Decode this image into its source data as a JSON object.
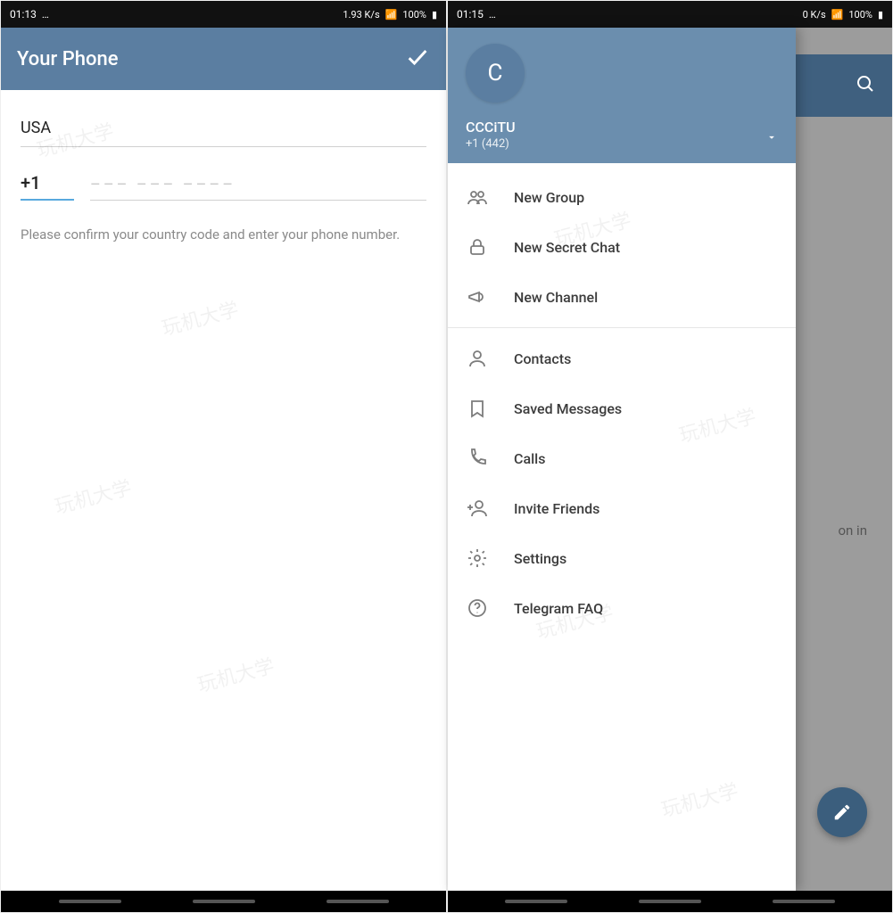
{
  "left": {
    "status": {
      "time": "01:13",
      "net_speed": "1.93 K/s",
      "battery": "100%"
    },
    "appbar": {
      "title": "Your Phone"
    },
    "login": {
      "country": "USA",
      "code": "+1",
      "placeholder": "––– ––– ––––",
      "hint": "Please confirm your country code and enter your phone number."
    }
  },
  "right": {
    "status": {
      "time": "01:15",
      "net_speed": "0 K/s",
      "battery": "100%"
    },
    "bg_text": "on in",
    "drawer": {
      "avatar_initial": "C",
      "username": "CCCiTU",
      "phone": "+1 (442)",
      "groups": [
        [
          {
            "key": "new-group",
            "label": "New Group",
            "icon": "group-icon"
          },
          {
            "key": "new-secret-chat",
            "label": "New Secret Chat",
            "icon": "lock-icon"
          },
          {
            "key": "new-channel",
            "label": "New Channel",
            "icon": "megaphone-icon"
          }
        ],
        [
          {
            "key": "contacts",
            "label": "Contacts",
            "icon": "person-icon"
          },
          {
            "key": "saved-messages",
            "label": "Saved Messages",
            "icon": "bookmark-icon"
          },
          {
            "key": "calls",
            "label": "Calls",
            "icon": "phone-icon"
          },
          {
            "key": "invite-friends",
            "label": "Invite Friends",
            "icon": "add-person-icon"
          },
          {
            "key": "settings",
            "label": "Settings",
            "icon": "gear-icon"
          },
          {
            "key": "telegram-faq",
            "label": "Telegram FAQ",
            "icon": "help-icon"
          }
        ]
      ]
    }
  },
  "watermark_text": "玩机大学"
}
